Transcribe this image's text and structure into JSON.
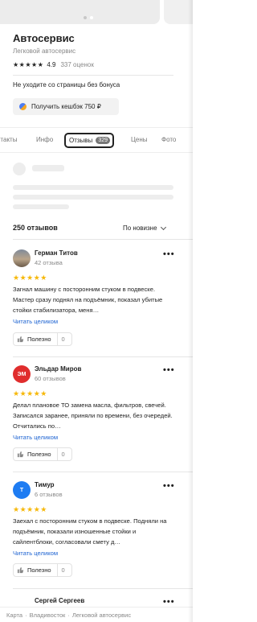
{
  "org": {
    "title": "Автосервис",
    "category": "Легковой автосервис",
    "stars": "★★★★★",
    "rating": "4.9",
    "rating_count": "337 оценок",
    "bonus_text": "Не уходите со страницы без бонуса",
    "cashback_label": "Получить кешбэк 750 ₽"
  },
  "tabs": {
    "contacts": "нтакты",
    "info": "Инфо",
    "reviews": "Отзывы",
    "reviews_count": "329",
    "prices": "Цены",
    "photo": "Фото"
  },
  "reviews_section": {
    "count_label": "250 отзывов",
    "sort_label": "По новизне"
  },
  "reviews": [
    {
      "author": "Герман Титов",
      "author_reviews": "42 отзыва",
      "avatar_text": "",
      "stars": "★★★★★",
      "text": "Загнал машину с посторонним стуком в подвеске. Мастер сразу поднял на подъёмник, показал убитые стойки стабилизатора, меня…",
      "read_more": "Читать целиком",
      "useful_label": "Полезно",
      "useful_count": "0"
    },
    {
      "author": "Эльдар Миров",
      "author_reviews": "60 отзывов",
      "avatar_text": "ЭМ",
      "stars": "★★★★★",
      "text": "Делал плановое ТО замена масла, фильтров, свечей. Записался заранее, приняли по времени, без очередей. Отчитались по…",
      "read_more": "Читать целиком",
      "useful_label": "Полезно",
      "useful_count": "0"
    },
    {
      "author": "Тимур",
      "author_reviews": "6 отзывов",
      "avatar_text": "Т",
      "stars": "★★★★★",
      "text": "Заехал с посторонним стуком в подвеске. Подняли на подъёмник, показали изношенные стойки и сайлентблоки, согласовали смету д…",
      "read_more": "Читать целиком",
      "useful_label": "Полезно",
      "useful_count": "0"
    },
    {
      "author": "Сергей Сергеев",
      "more": "•••"
    }
  ],
  "more_label": "•••",
  "footer": {
    "crumbs": [
      "Карта",
      "Владивосток",
      "Легковой автосервис"
    ],
    "sep": "·"
  }
}
